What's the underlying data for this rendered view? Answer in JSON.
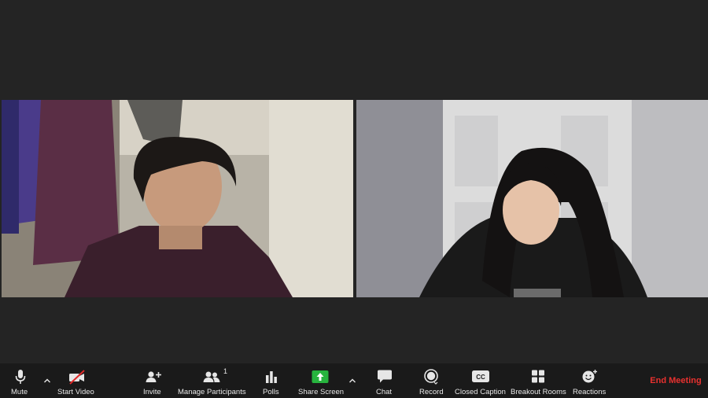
{
  "toolbar": {
    "mute_label": "Mute",
    "start_video_label": "Start Video",
    "invite_label": "Invite",
    "manage_participants_label": "Manage Participants",
    "participants_count": "1",
    "polls_label": "Polls",
    "share_screen_label": "Share Screen",
    "chat_label": "Chat",
    "record_label": "Record",
    "closed_caption_label": "Closed Caption",
    "cc_icon_text": "CC",
    "breakout_rooms_label": "Breakout Rooms",
    "reactions_label": "Reactions",
    "end_meeting_label": "End Meeting"
  },
  "icons": {
    "mute": "microphone-icon",
    "start_video": "video-off-icon",
    "invite": "add-person-icon",
    "manage_participants": "participants-icon",
    "polls": "bar-chart-icon",
    "share_screen": "share-screen-icon",
    "chat": "chat-bubble-icon",
    "record": "record-icon",
    "closed_caption": "cc-icon",
    "breakout_rooms": "grid-icon",
    "reactions": "smiley-plus-icon"
  },
  "colors": {
    "share_screen_green": "#27b43e",
    "end_meeting_red": "#e8312f",
    "video_off_slash": "#e02828",
    "toolbar_bg": "#1a1a1a",
    "stage_bg": "#242424"
  }
}
